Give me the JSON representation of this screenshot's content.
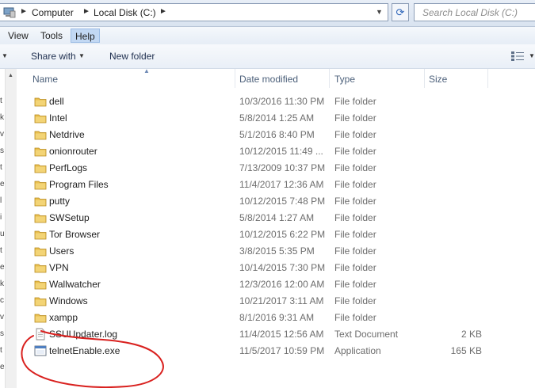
{
  "address": {
    "crumbs": [
      "Computer",
      "Local Disk (C:)"
    ],
    "search_placeholder": "Search Local Disk (C:)"
  },
  "menu": {
    "items": [
      "View",
      "Tools",
      "Help"
    ],
    "active": "Help"
  },
  "toolbar": {
    "share_label": "Share with",
    "new_folder_label": "New folder"
  },
  "nav_fragments": [
    "t",
    "k",
    "v",
    "s",
    "t",
    "e",
    "l",
    "i",
    "u",
    "t",
    "e",
    "k",
    "c",
    "v",
    "s",
    "t",
    "e"
  ],
  "columns": {
    "name": "Name",
    "date": "Date modified",
    "type": "Type",
    "size": "Size"
  },
  "files": [
    {
      "name": "dell",
      "date": "10/3/2016 11:30 PM",
      "type": "File folder",
      "size": "",
      "icon": "folder-icon"
    },
    {
      "name": "Intel",
      "date": "5/8/2014 1:25 AM",
      "type": "File folder",
      "size": "",
      "icon": "folder-icon"
    },
    {
      "name": "Netdrive",
      "date": "5/1/2016 8:40 PM",
      "type": "File folder",
      "size": "",
      "icon": "folder-icon"
    },
    {
      "name": "onionrouter",
      "date": "10/12/2015 11:49 ...",
      "type": "File folder",
      "size": "",
      "icon": "folder-icon"
    },
    {
      "name": "PerfLogs",
      "date": "7/13/2009 10:37 PM",
      "type": "File folder",
      "size": "",
      "icon": "folder-icon"
    },
    {
      "name": "Program Files",
      "date": "11/4/2017 12:36 AM",
      "type": "File folder",
      "size": "",
      "icon": "folder-icon"
    },
    {
      "name": "putty",
      "date": "10/12/2015 7:48 PM",
      "type": "File folder",
      "size": "",
      "icon": "folder-icon"
    },
    {
      "name": "SWSetup",
      "date": "5/8/2014 1:27 AM",
      "type": "File folder",
      "size": "",
      "icon": "folder-icon"
    },
    {
      "name": "Tor Browser",
      "date": "10/12/2015 6:22 PM",
      "type": "File folder",
      "size": "",
      "icon": "folder-icon"
    },
    {
      "name": "Users",
      "date": "3/8/2015 5:35 PM",
      "type": "File folder",
      "size": "",
      "icon": "folder-icon"
    },
    {
      "name": "VPN",
      "date": "10/14/2015 7:30 PM",
      "type": "File folder",
      "size": "",
      "icon": "folder-icon"
    },
    {
      "name": "Wallwatcher",
      "date": "12/3/2016 12:00 AM",
      "type": "File folder",
      "size": "",
      "icon": "folder-icon"
    },
    {
      "name": "Windows",
      "date": "10/21/2017 3:11 AM",
      "type": "File folder",
      "size": "",
      "icon": "folder-icon"
    },
    {
      "name": "xampp",
      "date": "8/1/2016 9:31 AM",
      "type": "File folder",
      "size": "",
      "icon": "folder-icon"
    },
    {
      "name": "SSUUpdater.log",
      "date": "11/4/2015 12:56 AM",
      "type": "Text Document",
      "size": "2 KB",
      "icon": "text-document-icon"
    },
    {
      "name": "telnetEnable.exe",
      "date": "11/5/2017 10:59 PM",
      "type": "Application",
      "size": "165 KB",
      "icon": "application-icon"
    }
  ],
  "colors": {
    "accent": "#c2d8f3",
    "annotation_red": "#d9211f",
    "folder": "#e9bf4f"
  }
}
